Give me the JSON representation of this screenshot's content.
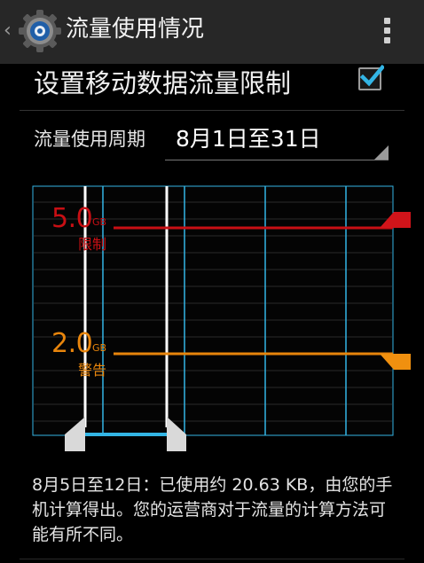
{
  "action_bar": {
    "title": "流量使用情况",
    "back_icon": "chevron-left-icon",
    "app_icon": "gear-icon",
    "menu_icon": "overflow-menu-icon"
  },
  "settings": {
    "limit_label": "设置移动数据流量限制",
    "limit_checked": true,
    "cycle_label": "流量使用周期",
    "cycle_value": "8月1日至31日"
  },
  "chart": {
    "limit_value": "5.0",
    "limit_unit": "GB",
    "limit_label": "限制",
    "warning_value": "2.0",
    "warning_unit": "GB",
    "warning_label": "警告"
  },
  "footer": {
    "summary": "8月5日至12日：已使用约 20.63 KB，由您的手机计算得出。您的运营商对于流量的计算方法可能有所不同。"
  },
  "colors": {
    "accent": "#33b5e5",
    "limit": "#c80f14",
    "warning": "#e8850c"
  }
}
